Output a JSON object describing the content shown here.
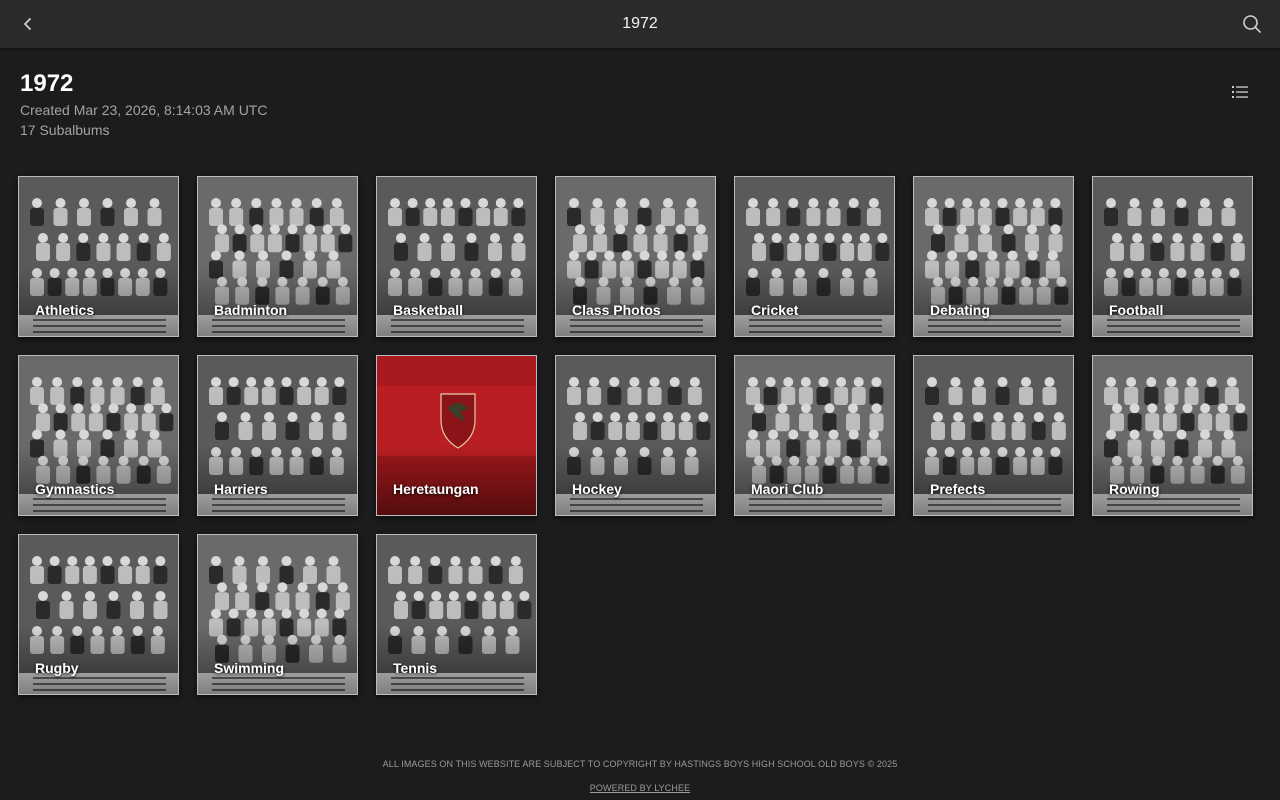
{
  "topbar": {
    "title": "1972",
    "back_icon": "chevron-left-icon",
    "search_icon": "search-icon"
  },
  "header": {
    "title": "1972",
    "created": "Created Mar 23, 2026, 8:14:03 AM UTC",
    "count": "17 Subalbums",
    "view_toggle_icon": "list-icon"
  },
  "albums": [
    {
      "label": "Athletics",
      "photo": "bw"
    },
    {
      "label": "Badminton",
      "photo": "bw"
    },
    {
      "label": "Basketball",
      "photo": "bw"
    },
    {
      "label": "Class Photos",
      "photo": "bw"
    },
    {
      "label": "Cricket",
      "photo": "bw"
    },
    {
      "label": "Debating",
      "photo": "bw"
    },
    {
      "label": "Football",
      "photo": "bw"
    },
    {
      "label": "Gymnastics",
      "photo": "bw"
    },
    {
      "label": "Harriers",
      "photo": "bw"
    },
    {
      "label": "Heretaungan",
      "photo": "cover"
    },
    {
      "label": "Hockey",
      "photo": "bw"
    },
    {
      "label": "Maori Club",
      "photo": "bw"
    },
    {
      "label": "Prefects",
      "photo": "bw"
    },
    {
      "label": "Rowing",
      "photo": "bw"
    },
    {
      "label": "Rugby",
      "photo": "bw"
    },
    {
      "label": "Swimming",
      "photo": "bw"
    },
    {
      "label": "Tennis",
      "photo": "bw"
    }
  ],
  "footer": {
    "copyright": "ALL IMAGES ON THIS WEBSITE ARE SUBJECT TO COPYRIGHT BY HASTINGS BOYS HIGH SCHOOL OLD BOYS © 2025",
    "powered": "POWERED BY LYCHEE"
  },
  "colors": {
    "background": "#1c1c1e",
    "topbar": "#2a2a2c",
    "cover_red": "#b81e22"
  }
}
